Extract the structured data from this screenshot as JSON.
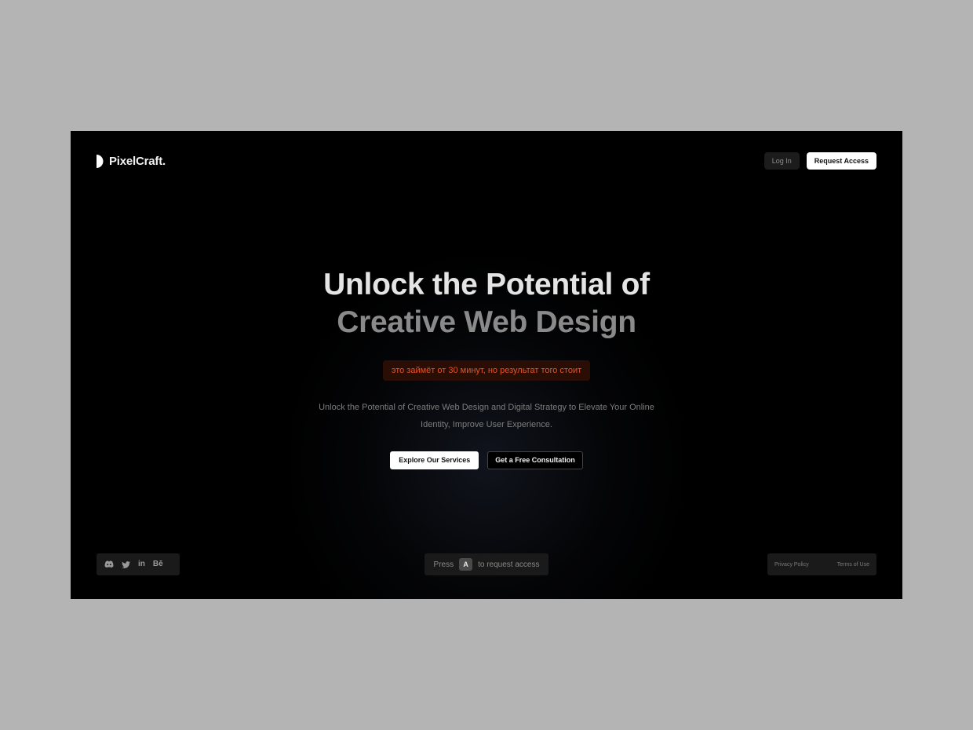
{
  "header": {
    "logo_text": "PixelCraft.",
    "login_label": "Log In",
    "request_label": "Request Access"
  },
  "hero": {
    "headline_line1": "Unlock the Potential of",
    "headline_line2": "Creative Web Design",
    "notice": "это займёт от 30 минут, но результат того стоит",
    "subtext": "Unlock the Potential of Creative Web Design and Digital Strategy to Elevate Your Online Identity, Improve User Experience.",
    "cta_primary": "Explore Our Services",
    "cta_secondary": "Get a Free Consultation"
  },
  "footer": {
    "social_icons": [
      "discord-icon",
      "twitter-icon",
      "linkedin-icon",
      "behance-icon"
    ],
    "linkedin_glyph": "in",
    "behance_glyph": "Bē",
    "shortcut_prefix": "Press",
    "shortcut_key": "A",
    "shortcut_suffix": "to request access",
    "privacy_label": "Privacy Policy",
    "terms_label": "Terms of Use"
  },
  "colors": {
    "page_background": "#b4b4b4",
    "frame_background": "#000000",
    "notice_text": "#e0542a",
    "notice_background": "#2a0e06"
  }
}
